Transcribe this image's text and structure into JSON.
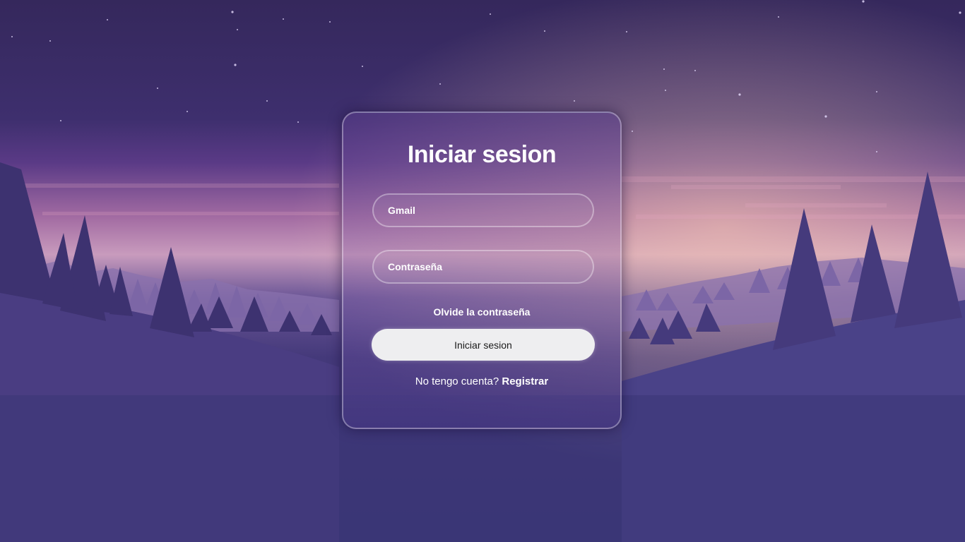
{
  "login": {
    "title": "Iniciar sesion",
    "email_placeholder": "Gmail",
    "password_placeholder": "Contraseña",
    "forgot_label": "Olvide la contraseña",
    "submit_label": "Iniciar sesion",
    "no_account_text": "No tengo cuenta?",
    "register_label": "Registrar"
  },
  "colors": {
    "sky_top": "#35285c",
    "horizon_glow": "#c89bbd",
    "ground": "#3a3575",
    "button_bg": "#eeeef0",
    "text": "#ffffff"
  }
}
